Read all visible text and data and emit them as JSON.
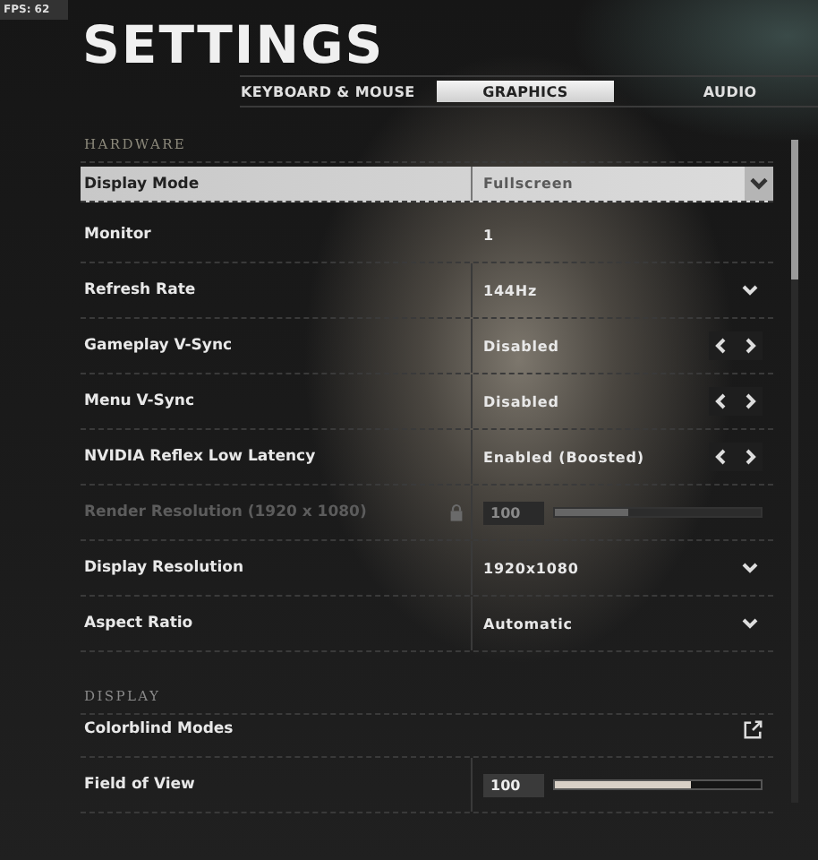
{
  "fps": "FPS: 62",
  "title": "SETTINGS",
  "tabs": [
    {
      "label": "KEYBOARD & MOUSE",
      "selected": false
    },
    {
      "label": "GRAPHICS",
      "selected": true
    },
    {
      "label": "AUDIO",
      "selected": false
    }
  ],
  "sections": [
    {
      "heading": "HARDWARE",
      "rows": [
        {
          "kind": "dropdown",
          "label": "Display Mode",
          "value": "Fullscreen",
          "selected": true,
          "disabled": false
        },
        {
          "kind": "text",
          "label": "Monitor",
          "value": "1",
          "selected": false,
          "disabled": false
        },
        {
          "kind": "dropdown",
          "label": "Refresh Rate",
          "value": "144Hz",
          "selected": false,
          "disabled": false
        },
        {
          "kind": "stepper",
          "label": "Gameplay V-Sync",
          "value": "Disabled",
          "selected": false,
          "disabled": false
        },
        {
          "kind": "stepper",
          "label": "Menu V-Sync",
          "value": "Disabled",
          "selected": false,
          "disabled": false
        },
        {
          "kind": "stepper",
          "label": "NVIDIA Reflex Low Latency",
          "value": "Enabled (Boosted)",
          "selected": false,
          "disabled": false
        },
        {
          "kind": "slider",
          "label": "Render Resolution (1920 x 1080)",
          "value": "100",
          "level": 0.36,
          "selected": false,
          "disabled": true
        },
        {
          "kind": "dropdown",
          "label": "Display Resolution",
          "value": "1920x1080",
          "selected": false,
          "disabled": false
        },
        {
          "kind": "dropdown",
          "label": "Aspect Ratio",
          "value": "Automatic",
          "selected": false,
          "disabled": false
        }
      ]
    },
    {
      "heading": "DISPLAY",
      "rows": [
        {
          "kind": "external",
          "label": "Colorblind Modes",
          "selected": false,
          "disabled": false
        },
        {
          "kind": "slider",
          "label": "Field of View",
          "value": "100",
          "level": 0.66,
          "selected": false,
          "disabled": false
        }
      ]
    }
  ]
}
